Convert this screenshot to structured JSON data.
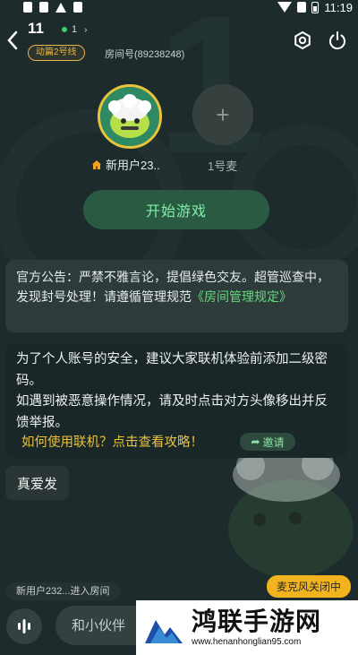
{
  "status_bar": {
    "time": "11:19"
  },
  "header": {
    "room_title": "11",
    "online_count": "1",
    "line_badge": "动篇2号线",
    "room_id": "房间号(89238248)"
  },
  "seats": [
    {
      "name": "新用户23..",
      "owner": true
    },
    {
      "name": "1号麦"
    }
  ],
  "start_button": "开始游戏",
  "notice": {
    "text": "官方公告：严禁不雅言论，提倡绿色交友。超管巡查中，发现封号处理！请遵循管理规范",
    "link": "《房间管理规定》"
  },
  "tips": {
    "line1": "为了个人账号的安全，建议大家联机体验前添加二级密码。",
    "line2": "如遇到被恶意操作情况，请及时点击对方头像移出并反馈举报。",
    "guide_link": "如何使用联机？点击查看攻略！",
    "invite_label": "邀请"
  },
  "chat_message": "真爱发",
  "enter_tip": "新用户232...进入房间",
  "mic_status": "麦克风关闭中",
  "chat_input": {
    "placeholder": "和小伙伴"
  },
  "watermark": {
    "title": "鸿联手游网",
    "url": "www.henanhonglian95.com"
  },
  "colors": {
    "background": "#1e2b2c",
    "accent_green": "#67d77e",
    "badge_gold": "#e5b44a",
    "mic_status_bg": "#f2b41e"
  }
}
